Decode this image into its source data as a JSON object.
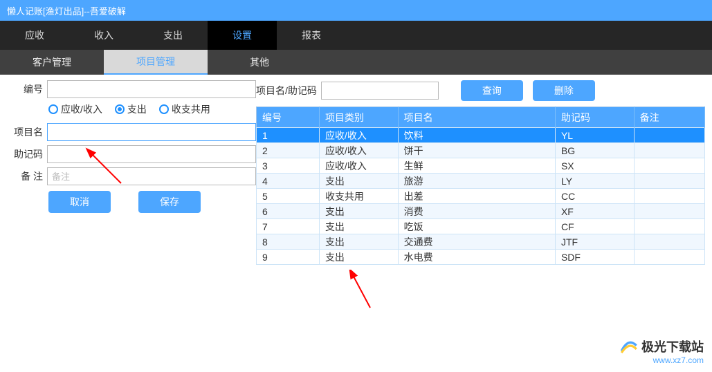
{
  "title": "懒人记账[渔灯出品]--吾爱破解",
  "mainnav": {
    "items": [
      "应收",
      "收入",
      "支出",
      "设置",
      "报表"
    ],
    "active": 3
  },
  "subnav": {
    "items": [
      "客户管理",
      "项目管理",
      "其他"
    ],
    "active": 1
  },
  "form": {
    "labels": {
      "code": "编号",
      "name": "项目名",
      "mnemonic": "助记码",
      "note": "备 注"
    },
    "radios": {
      "income": "应收/收入",
      "expense": "支出",
      "both": "收支共用"
    },
    "note_placeholder": "备注",
    "buttons": {
      "cancel": "取消",
      "save": "保存"
    }
  },
  "search": {
    "label": "项目名/助记码",
    "query_btn": "查询",
    "delete_btn": "删除"
  },
  "grid": {
    "headers": {
      "num": "编号",
      "category": "项目类别",
      "name": "项目名",
      "mnemonic": "助记码",
      "note": "备注"
    },
    "rows": [
      {
        "num": "1",
        "category": "应收/收入",
        "name": "饮料",
        "mnemonic": "YL",
        "note": ""
      },
      {
        "num": "2",
        "category": "应收/收入",
        "name": "饼干",
        "mnemonic": "BG",
        "note": ""
      },
      {
        "num": "3",
        "category": "应收/收入",
        "name": "生鲜",
        "mnemonic": "SX",
        "note": ""
      },
      {
        "num": "4",
        "category": "支出",
        "name": "旅游",
        "mnemonic": "LY",
        "note": ""
      },
      {
        "num": "5",
        "category": "收支共用",
        "name": "出差",
        "mnemonic": "CC",
        "note": ""
      },
      {
        "num": "6",
        "category": "支出",
        "name": "消费",
        "mnemonic": "XF",
        "note": ""
      },
      {
        "num": "7",
        "category": "支出",
        "name": "吃饭",
        "mnemonic": "CF",
        "note": ""
      },
      {
        "num": "8",
        "category": "支出",
        "name": "交通费",
        "mnemonic": "JTF",
        "note": ""
      },
      {
        "num": "9",
        "category": "支出",
        "name": "水电费",
        "mnemonic": "SDF",
        "note": ""
      }
    ],
    "selected_index": 0
  },
  "watermark": {
    "brand": "极光下载站",
    "url": "www.xz7.com"
  }
}
